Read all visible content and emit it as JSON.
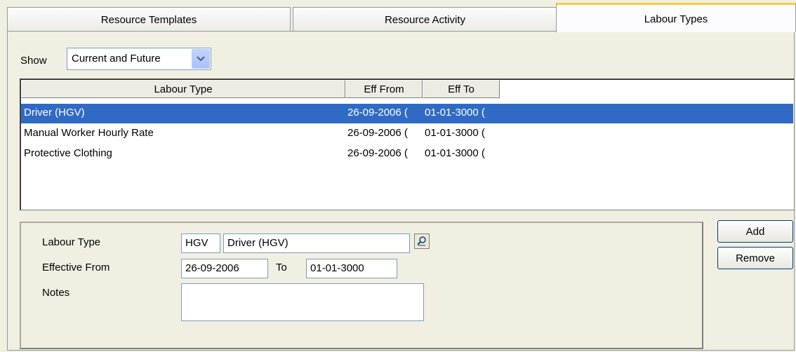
{
  "tabs": [
    {
      "label": "Resource Templates",
      "active": false
    },
    {
      "label": "Resource Activity",
      "active": false
    },
    {
      "label": "Labour Types",
      "active": true
    }
  ],
  "filter": {
    "show_label": "Show",
    "selected": "Current and Future"
  },
  "list": {
    "columns": [
      "Labour Type",
      "Eff From",
      "Eff To"
    ],
    "rows": [
      {
        "type": "Driver (HGV)",
        "from": "26-09-2006 (",
        "to": "01-01-3000 (",
        "selected": true
      },
      {
        "type": "Manual Worker Hourly Rate",
        "from": "26-09-2006 (",
        "to": "01-01-3000 (",
        "selected": false
      },
      {
        "type": "Protective Clothing",
        "from": "26-09-2006 (",
        "to": "01-01-3000 (",
        "selected": false
      }
    ]
  },
  "detail": {
    "labour_type_label": "Labour Type",
    "labour_code": "HGV",
    "labour_desc": "Driver (HGV)",
    "effective_from_label": "Effective From",
    "effective_from": "26-09-2006",
    "to_label": "To",
    "effective_to": "01-01-3000",
    "notes_label": "Notes",
    "notes": ""
  },
  "actions": {
    "add_label": "Add",
    "remove_label": "Remove"
  },
  "colors": {
    "selection": "#316ac5",
    "active_tab_accent": "#ffc83c"
  }
}
